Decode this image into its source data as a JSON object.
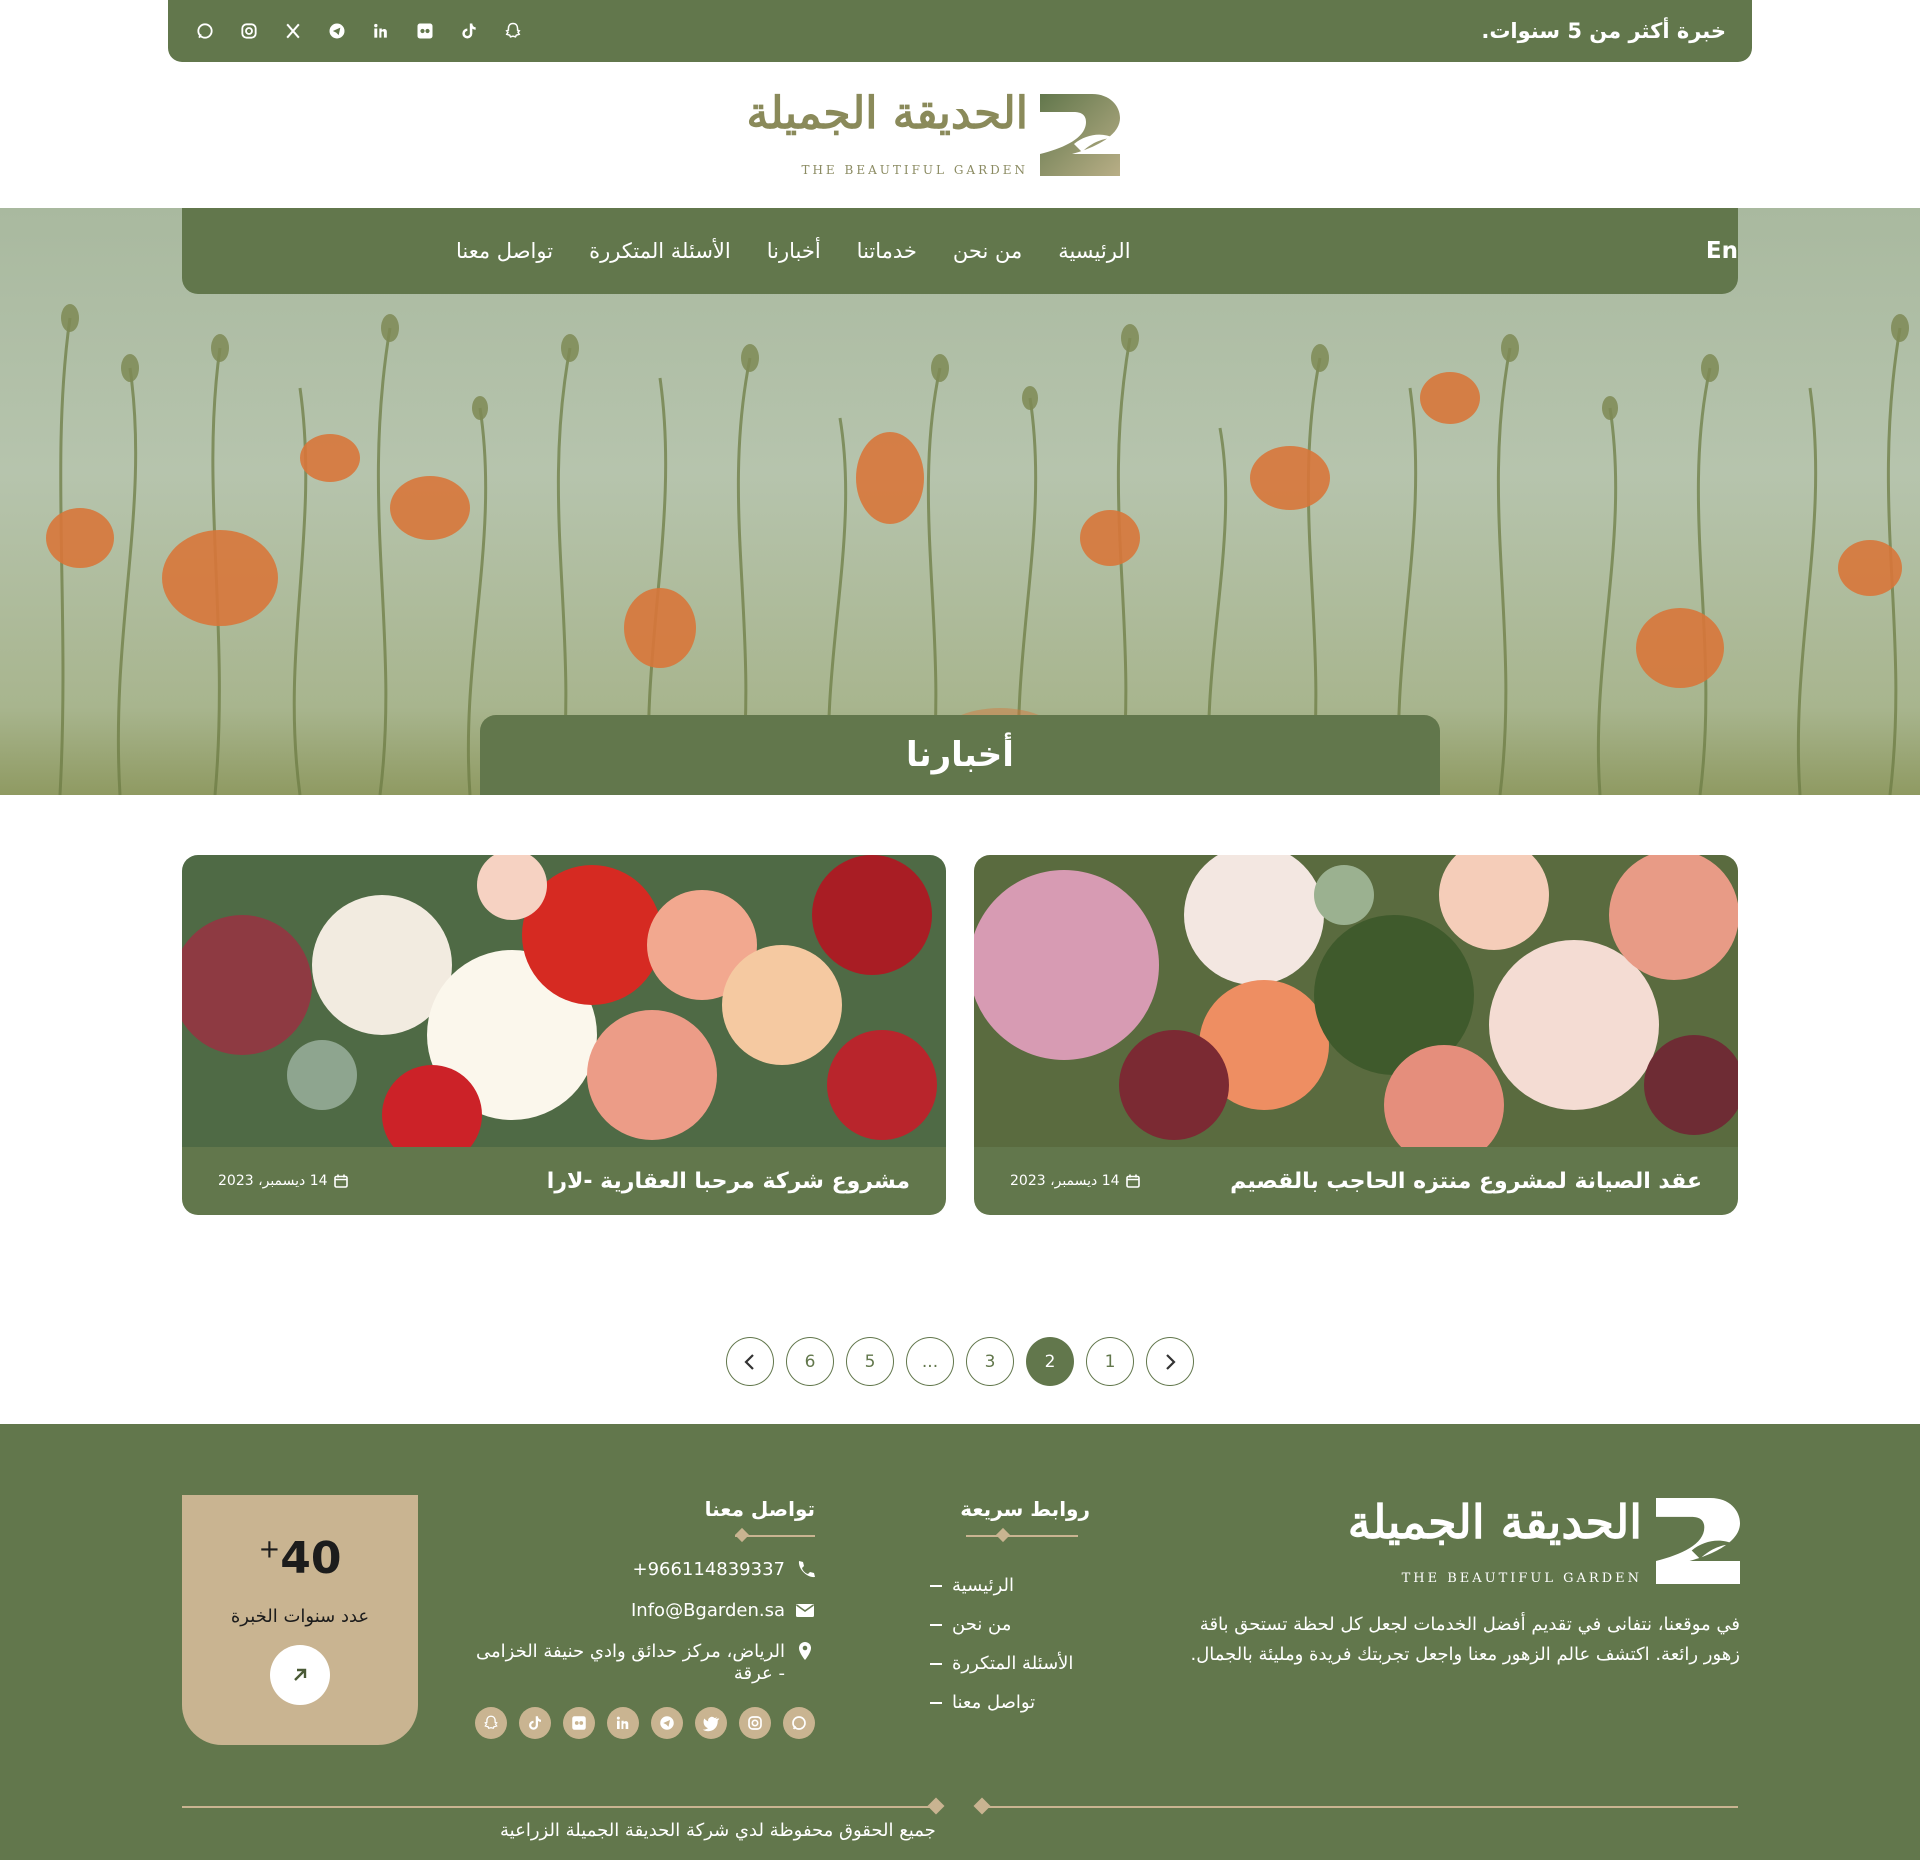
{
  "topbar": {
    "experience": "خبرة أكثر من 5 سنوات.",
    "socials": [
      "whatsapp-icon",
      "instagram-icon",
      "x-icon",
      "telegram-icon",
      "linkedin-icon",
      "flickr-icon",
      "tiktok-icon",
      "snapchat-icon"
    ]
  },
  "logo": {
    "arabic": "الحديقة الجميلة",
    "english": "THE BEAUTIFUL GARDEN"
  },
  "nav": {
    "items": [
      "الرئيسية",
      "من نحن",
      "خدماتنا",
      "أخبارنا",
      "الأسئلة المتكررة",
      "تواصل معنا"
    ],
    "lang": "En"
  },
  "hero": {
    "title": "أخبارنا"
  },
  "cards": [
    {
      "title": "عقد الصيانة لمشروع منتزه الحاجب بالقصيم",
      "date": "14 ديسمبر، 2023"
    },
    {
      "title": "مشروع شركة مرحبا العقارية -لارا",
      "date": "14 ديسمبر، 2023"
    }
  ],
  "pagination": {
    "pages": [
      "1",
      "2",
      "3",
      "...",
      "5",
      "6"
    ],
    "active": "2"
  },
  "footer": {
    "description": "في موقعنا، نتفانى في تقديم أفضل الخدمات لجعل كل لحظة تستحق باقة زهور رائعة. اكتشف عالم الزهور معنا واجعل تجربتك فريدة ومليئة بالجمال.",
    "quick_links_title": "روابط سريعة",
    "quick_links": [
      "الرئيسية",
      "من نحن",
      "الأسئلة المتكررة",
      "تواصل معنا"
    ],
    "contact_title": "تواصل معنا",
    "phone": "+966114839337",
    "email": "Info@Bgarden.sa",
    "address": "الرياض، مركز حدائق وادي حنيفة الخزامى - عرقة",
    "experience_number": "40",
    "experience_plus": "+",
    "experience_label": "عدد سنوات الخبرة",
    "copyright": "جميع الحقوق محفوظة لدي شركة الحديقة الجميلة الزراعية"
  },
  "colors": {
    "primary": "#62774c",
    "accent": "#c9b491"
  }
}
